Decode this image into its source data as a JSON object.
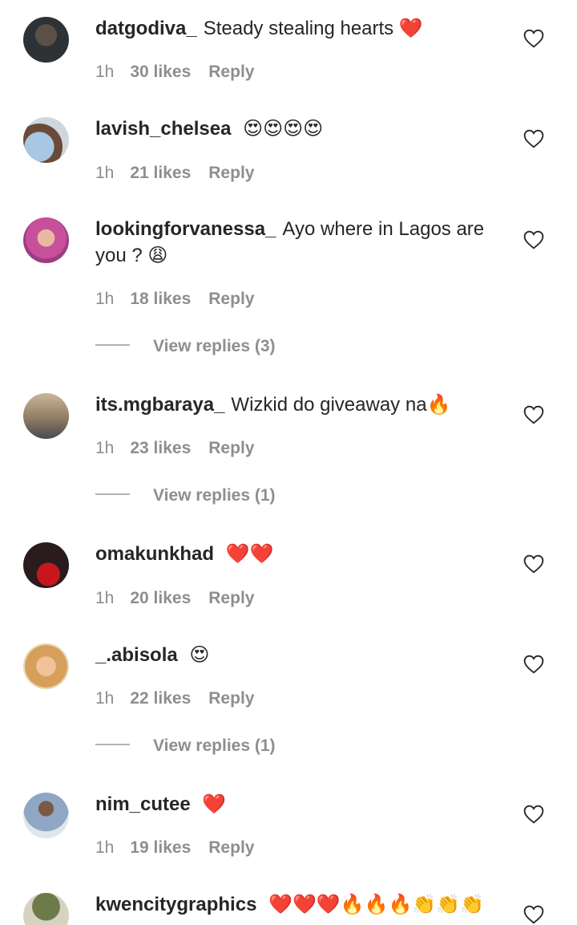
{
  "comments": [
    {
      "username": "datgodiva_",
      "text": "Steady stealing hearts",
      "emoji": "❤️",
      "time": "1h",
      "likes": "30 likes",
      "reply": "Reply",
      "avatar_color": "#3a3f44"
    },
    {
      "username": "lavish_chelsea",
      "text": "",
      "emoji": "😍😍😍😍",
      "time": "1h",
      "likes": "21 likes",
      "reply": "Reply",
      "avatar_color": "#8fb4d6"
    },
    {
      "username": "lookingforvanessa_",
      "text": "Ayo where in Lagos are you ?",
      "emoji": "😩",
      "time": "1h",
      "likes": "18 likes",
      "reply": "Reply",
      "view_replies": "View replies (3)",
      "avatar_color": "#c7509b"
    },
    {
      "username": "its.mgbaraya_",
      "text": "Wizkid do giveaway na",
      "emoji": "🔥",
      "time": "1h",
      "likes": "23 likes",
      "reply": "Reply",
      "view_replies": "View replies (1)",
      "avatar_color": "#9b8a72"
    },
    {
      "username": "omakunkhad",
      "text": "",
      "emoji": "❤️❤️",
      "time": "1h",
      "likes": "20 likes",
      "reply": "Reply",
      "avatar_color": "#3a1a1a"
    },
    {
      "username": "_.abisola",
      "text": "",
      "emoji": "😍",
      "time": "1h",
      "likes": "22 likes",
      "reply": "Reply",
      "view_replies": "View replies (1)",
      "avatar_color": "#d9a15a"
    },
    {
      "username": "nim_cutee",
      "text": "",
      "emoji": "❤️",
      "time": "1h",
      "likes": "19 likes",
      "reply": "Reply",
      "avatar_color": "#6b86a8"
    },
    {
      "username": "kwencitygraphics",
      "text": "",
      "emoji": "❤️❤️❤️🔥🔥🔥👏👏👏",
      "avatar_color": "#5a6b3a"
    }
  ],
  "icons": {
    "like": "heart-outline-icon"
  }
}
